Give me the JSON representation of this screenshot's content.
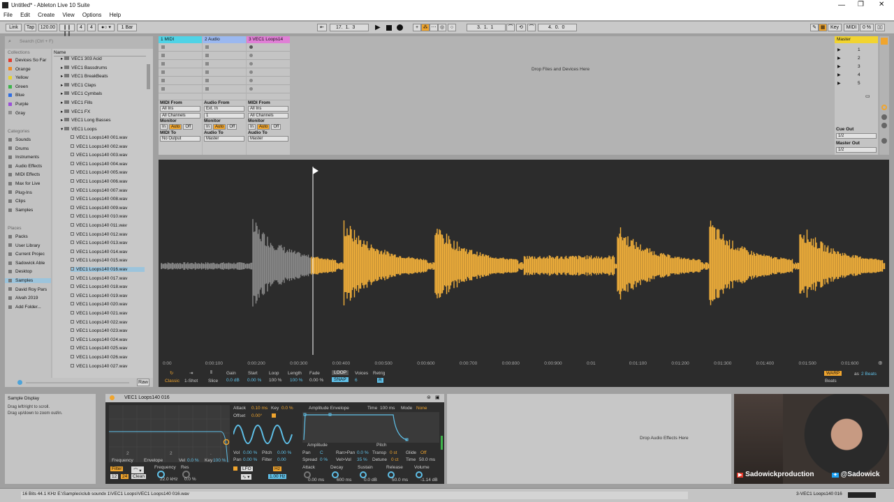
{
  "title": "Untitled* - Ableton Live 10 Suite",
  "menu": [
    "File",
    "Edit",
    "Create",
    "View",
    "Options",
    "Help"
  ],
  "control": {
    "link": "Link",
    "tap": "Tap",
    "tempo": "120.00",
    "sig_num": "4",
    "sig_den": "4",
    "quant": "1 Bar",
    "pos_bar": "17",
    "pos_beat": "1",
    "pos_six": "3",
    "loop_bar": "3",
    "loop_beat": "1",
    "loop_six": "1",
    "len_bar": "4",
    "len_beat": "0",
    "len_six": "0",
    "key": "Key",
    "midi": "MIDI",
    "cpu": "0 %"
  },
  "browser": {
    "search_placeholder": "Search (Ctrl + F)",
    "collections_head": "Collections",
    "name_head": "Name",
    "collections": [
      {
        "label": "Devices So Far",
        "color": "#e23b2d"
      },
      {
        "label": "Orange",
        "color": "#f08a24"
      },
      {
        "label": "Yellow",
        "color": "#e9d42b"
      },
      {
        "label": "Green",
        "color": "#3db34a"
      },
      {
        "label": "Blue",
        "color": "#2d6de3"
      },
      {
        "label": "Purple",
        "color": "#9a4fd8"
      },
      {
        "label": "Gray",
        "color": "#8c8c8c"
      }
    ],
    "categories_head": "Categories",
    "categories": [
      "Sounds",
      "Drums",
      "Instruments",
      "Audio Effects",
      "MIDI Effects",
      "Max for Live",
      "Plug-Ins",
      "Clips",
      "Samples"
    ],
    "places_head": "Places",
    "places": [
      "Packs",
      "User Library",
      "Current Projec",
      "Sadowick Able",
      "Desktop",
      "Samples",
      "David Roy Pars",
      "Alvah 2019",
      "Add Folder..."
    ],
    "folders": [
      "VEC1 303 Acid",
      "VEC1 Bassdrums",
      "VEC1 BreakBeats",
      "VEC1 Claps",
      "VEC1 Cymbals",
      "VEC1 Fills",
      "VEC1 FX",
      "VEC1 Long Basses",
      "VEC1 Loops"
    ],
    "files": [
      "VEC1 Loops140 001.wav",
      "VEC1 Loops140 002.wav",
      "VEC1 Loops140 003.wav",
      "VEC1 Loops140 004.wav",
      "VEC1 Loops140 005.wav",
      "VEC1 Loops140 006.wav",
      "VEC1 Loops140 007.wav",
      "VEC1 Loops140 008.wav",
      "VEC1 Loops140 009.wav",
      "VEC1 Loops140 010.wav",
      "VEC1 Loops140 011.wav",
      "VEC1 Loops140 012.wav",
      "VEC1 Loops140 013.wav",
      "VEC1 Loops140 014.wav",
      "VEC1 Loops140 015.wav",
      "VEC1 Loops140 016.wav",
      "VEC1 Loops140 017.wav",
      "VEC1 Loops140 018.wav",
      "VEC1 Loops140 019.wav",
      "VEC1 Loops140 020.wav",
      "VEC1 Loops140 021.wav",
      "VEC1 Loops140 022.wav",
      "VEC1 Loops140 023.wav",
      "VEC1 Loops140 024.wav",
      "VEC1 Loops140 025.wav",
      "VEC1 Loops140 026.wav",
      "VEC1 Loops140 027.wav"
    ],
    "raw": "Raw"
  },
  "tracks": [
    {
      "name": "1 MIDI",
      "color": "#4fd3e6",
      "from_label": "MIDI From",
      "from": "All Ins",
      "ch": "All Channels",
      "to_label": "MIDI To",
      "to": "No Output"
    },
    {
      "name": "2 Audio",
      "color": "#9bb8f0",
      "from_label": "Audio From",
      "from": "Ext. In",
      "ch": "1",
      "to_label": "Audio To",
      "to": "Master"
    },
    {
      "name": "3 VEC1 Loops14",
      "color": "#e07fd6",
      "from_label": "MIDI From",
      "from": "All Ins",
      "ch": "All Channels",
      "to_label": "Audio To",
      "to": "Master"
    }
  ],
  "monitor": {
    "label": "Monitor",
    "in": "In",
    "auto": "Auto",
    "off": "Off"
  },
  "drop_devices": "Drop Files and Devices Here",
  "master": {
    "name": "Master",
    "scenes": [
      "1",
      "2",
      "3",
      "4",
      "5"
    ],
    "cue_label": "Cue Out",
    "cue": "1/2",
    "out_label": "Master Out",
    "out": "1/2"
  },
  "clip": {
    "ruler": [
      "0:00",
      "0:00:100",
      "0:00:200",
      "0:00:300",
      "0:00:400",
      "0:00:500",
      "0:00:600",
      "0:00:700",
      "0:00:800",
      "0:00:900",
      "0:01",
      "0:01:100",
      "0:01:200",
      "0:01:300",
      "0:01:400",
      "0:01:500",
      "0:01:600"
    ],
    "classic": "Classic",
    "oneshot": "1-Shot",
    "slice": "Slice",
    "gain_l": "Gain",
    "gain": "0.0 dB",
    "start_l": "Start",
    "start": "0.00 %",
    "loop_l": "Loop",
    "loop": "100 %",
    "length_l": "Length",
    "length": "100 %",
    "fade_l": "Fade",
    "fade": "0.00 %",
    "loop_btn": "LOOP",
    "snap": "SNAP",
    "voices_l": "Voices",
    "voices": "6",
    "retrig_l": "Retrig",
    "retrig": "R",
    "warp": "WARP",
    "as": "as",
    "beats": "2 Beats",
    "beats_l": "Beats"
  },
  "info": {
    "title": "Sample Display",
    "line1": "Drag left/right to scroll.",
    "line2": "Drag up/down to zoom out/in."
  },
  "device": {
    "name": "VEC1 Loops140 016",
    "freq": "22.0 kHz",
    "frequency": "Frequency",
    "envelope": "Envelope",
    "vel": "Vel",
    "vel_v": "0.0 %",
    "key": "Key",
    "key_v": "100 %",
    "attack_l": "Attack",
    "attack": "0.10 ms",
    "key2": "Key",
    "key2_v": "0.0 %",
    "offset_l": "Offset",
    "offset": "0.00°",
    "vol_l": "Vol",
    "vol": "0.00 %",
    "pitch_l": "Pitch",
    "pitch": "0.00 %",
    "pan_l": "Pan",
    "pan": "0.00 %",
    "filter_l": "Filter",
    "filter": "0.00",
    "lfo": "LFO",
    "hz": "Hz",
    "lfo_rate": "1.00 Hz",
    "amp_env": "Amplitude Envelope",
    "time_l": "Time",
    "time": "100 ms",
    "mode_l": "Mode",
    "mode": "None",
    "amplitude": "Amplitude",
    "pitch2": "Pitch",
    "pan2_l": "Pan",
    "pan2": "C",
    "ranpan_l": "Ran>Pan",
    "ranpan": "0.0 %",
    "transp_l": "Transp",
    "transp": "0 st",
    "glide_l": "Glide",
    "glide": "Off",
    "spread_l": "Spread",
    "spread": "0 %",
    "velvol_l": "Vel>Vol",
    "velvol": "35 %",
    "detune_l": "Detune",
    "detune": "0 ct",
    "time2_l": "Time",
    "time2": "50.0 ms",
    "filter2": "Filter",
    "freq_l": "Frequency",
    "res_l": "Res",
    "res": "0.0 %",
    "clean": "Clean",
    "f12": "12",
    "f24": "24",
    "att_l": "Attack",
    "att": "0.00 ms",
    "dec_l": "Decay",
    "dec": "600 ms",
    "sus_l": "Sustain",
    "sus": "0.0 dB",
    "rel_l": "Release",
    "rel": "50.0 ms",
    "volm_l": "Volume",
    "volm": "-1.14 dB"
  },
  "drop_fx": "Drop Audio Effects Here",
  "webcam": {
    "yt": "Sadowickproduction",
    "tw": "@Sadowick"
  },
  "status": {
    "text": "16 Bits 44.1 KHz E:\\Samples\\club soundx 1\\VEC1 Loops\\VEC1 Loops140 016.wav",
    "track": "3-VEC1 Loops140 016"
  }
}
